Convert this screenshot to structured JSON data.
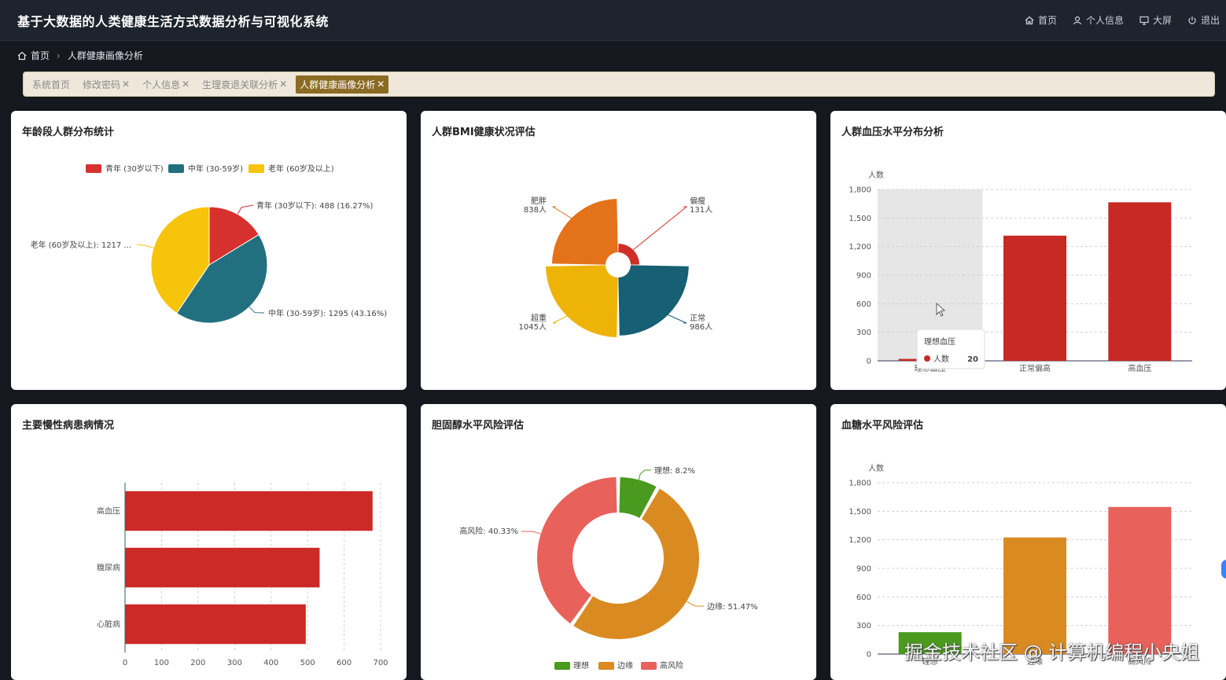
{
  "app": {
    "title": "基于大数据的人类健康生活方式数据分析与可视化系统",
    "nav": [
      {
        "icon": "home-icon",
        "label": "首页"
      },
      {
        "icon": "user-icon",
        "label": "个人信息"
      },
      {
        "icon": "monitor-icon",
        "label": "大屏"
      },
      {
        "icon": "power-icon",
        "label": "退出"
      }
    ]
  },
  "breadcrumb": {
    "home": "首页",
    "current": "人群健康画像分析"
  },
  "tags": [
    {
      "label": "系统首页",
      "closable": false,
      "active": false
    },
    {
      "label": "修改密码",
      "closable": true,
      "active": false
    },
    {
      "label": "个人信息",
      "closable": true,
      "active": false
    },
    {
      "label": "生理衰退关联分析",
      "closable": true,
      "active": false
    },
    {
      "label": "人群健康画像分析",
      "closable": true,
      "active": true
    }
  ],
  "cards": {
    "age": {
      "title": "年龄段人群分布统计"
    },
    "bmi": {
      "title": "人群BMI健康状况评估"
    },
    "bp": {
      "title": "人群血压水平分布分析"
    },
    "chronic": {
      "title": "主要慢性病患病情况"
    },
    "chol": {
      "title": "胆固醇水平风险评估"
    },
    "sugar": {
      "title": "血糖水平风险评估"
    }
  },
  "chart_data": [
    {
      "id": "age",
      "type": "pie",
      "title": "年龄段人群分布统计",
      "legend": [
        "青年 (30岁以下)",
        "中年 (30-59岁)",
        "老年 (60岁及以上)"
      ],
      "slices": [
        {
          "name": "青年 (30岁以下)",
          "value": 488,
          "percent": "16.27%",
          "color": "#d6312f",
          "label": "青年 (30岁以下): 488 (16.27%)"
        },
        {
          "name": "中年 (30-59岁)",
          "value": 1295,
          "percent": "43.16%",
          "color": "#22707f",
          "label": "中年 (30-59岁): 1295 (43.16%)"
        },
        {
          "name": "老年 (60岁及以上)",
          "value": 1217,
          "percent": "40.57%",
          "color": "#f6c40b",
          "label": "老年 (60岁及以上): 1217 ..."
        }
      ]
    },
    {
      "id": "bmi",
      "type": "pie",
      "title": "人群BMI健康状况评估",
      "rose": true,
      "slices": [
        {
          "name": "偏瘦",
          "value": 131,
          "label": "131人",
          "color": "#d02f27"
        },
        {
          "name": "正常",
          "value": 986,
          "label": "986人",
          "color": "#175f72"
        },
        {
          "name": "超重",
          "value": 1045,
          "label": "1045人",
          "color": "#eeb307"
        },
        {
          "name": "肥胖",
          "value": 838,
          "label": "838人",
          "color": "#e3721a"
        }
      ]
    },
    {
      "id": "bp",
      "type": "bar",
      "title": "人群血压水平分布分析",
      "ylabel": "人数",
      "categories": [
        "理想血压",
        "正常偏高",
        "高血压"
      ],
      "values": [
        20,
        1315,
        1665
      ],
      "ylim": [
        0,
        1800
      ],
      "yticks": [
        0,
        300,
        600,
        900,
        1200,
        1500,
        1800
      ],
      "color": "#c62a22",
      "tooltip": {
        "category": "理想血压",
        "series": "人数",
        "value": "20"
      }
    },
    {
      "id": "chronic",
      "type": "bar",
      "orientation": "horizontal",
      "title": "主要慢性病患病情况",
      "categories": [
        "高血压",
        "糖尿病",
        "心脏病"
      ],
      "values": [
        678,
        533,
        495
      ],
      "xlim": [
        0,
        700
      ],
      "xticks": [
        0,
        100,
        200,
        300,
        400,
        500,
        600,
        700
      ],
      "color": "#cc2a26"
    },
    {
      "id": "chol",
      "type": "pie",
      "donut": true,
      "title": "胆固醇水平风险评估",
      "legend": [
        "理想",
        "边缘",
        "高风险"
      ],
      "slices": [
        {
          "name": "理想",
          "percent": 8.2,
          "label": "理想: 8.2%",
          "color": "#4a9a1f"
        },
        {
          "name": "边缘",
          "percent": 51.47,
          "label": "边缘: 51.47%",
          "color": "#d98b22"
        },
        {
          "name": "高风险",
          "percent": 40.33,
          "label": "高风险: 40.33%",
          "color": "#e8615a"
        }
      ]
    },
    {
      "id": "sugar",
      "type": "bar",
      "title": "血糖水平风险评估",
      "ylabel": "人数",
      "categories": [
        "理想",
        "边缘",
        "高风险"
      ],
      "values": [
        230,
        1225,
        1545
      ],
      "colors": [
        "#4a9a1f",
        "#d98b22",
        "#e8615a"
      ],
      "ylim": [
        0,
        1800
      ],
      "yticks": [
        0,
        300,
        600,
        900,
        1200,
        1500,
        1800
      ]
    }
  ],
  "watermark": "掘金技术社区 @ 计算机编程小央姐"
}
